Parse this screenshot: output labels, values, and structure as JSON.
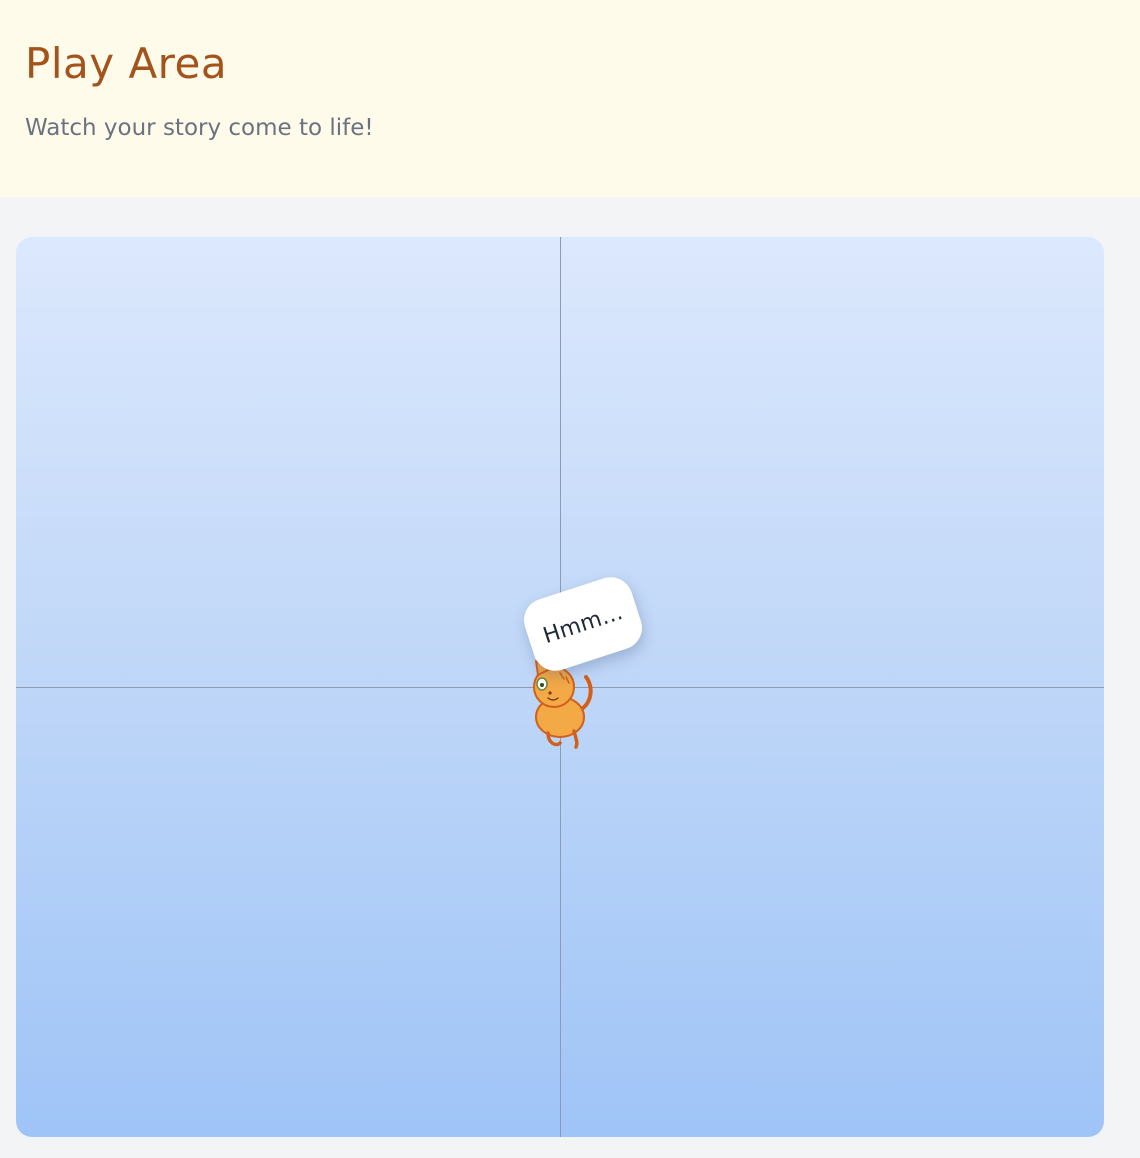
{
  "header": {
    "title": "Play Area",
    "subtitle": "Watch your story come to life!"
  },
  "stage": {
    "sprite": {
      "name": "cat-sprite",
      "speech": "Hmm..."
    }
  },
  "colors": {
    "title": "#a3541c",
    "header_background": "#fffbea",
    "stage_top": "#dce8fd",
    "stage_bottom": "#9fc4f7",
    "axis": "#8b9bb1",
    "cat_body": "#f4a947",
    "cat_outline": "#d2601a"
  }
}
